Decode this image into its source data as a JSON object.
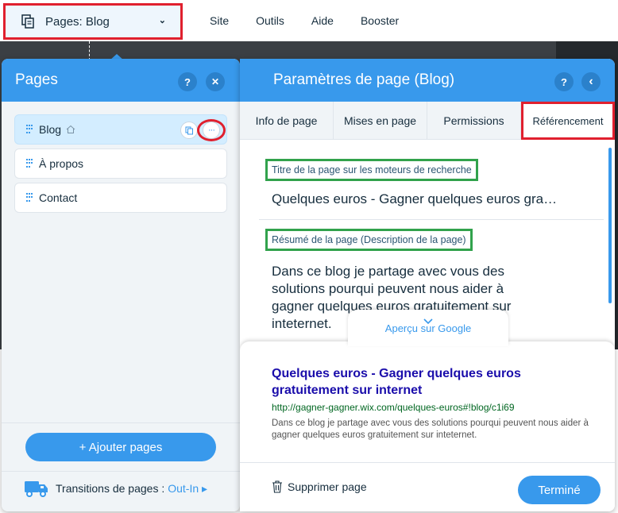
{
  "topbar": {
    "pages_dropdown_label": "Pages: Blog",
    "menu": [
      "Site",
      "Outils",
      "Aide",
      "Booster"
    ]
  },
  "pages_panel": {
    "title": "Pages",
    "help_label": "?",
    "close_label": "✕",
    "items": [
      {
        "label": "Blog"
      },
      {
        "label": "À propos"
      },
      {
        "label": "Contact"
      }
    ],
    "more_label": "···",
    "add_button": "+ Ajouter pages",
    "transitions_label": "Transitions de pages :",
    "transitions_value": "Out-In ▸"
  },
  "settings_panel": {
    "title": "Paramètres de page (Blog)",
    "help_label": "?",
    "back_label": "‹",
    "tabs": [
      "Info de page",
      "Mises en page",
      "Permissions",
      "Référencement"
    ],
    "seo_title_label": "Titre de la page sur les moteurs de recherche",
    "seo_title_value": "Quelques euros - Gagner quelques euros gra…",
    "summary_label": "Résumé de la page (Description de la page)",
    "summary_value": "Dans ce blog je partage avec vous des solutions pourqui peuvent nous aider à gagner quelques euros gratuitement sur inteternet.",
    "google_preview_label": "Aperçu sur Google",
    "google_title": "Quelques euros - Gagner quelques euros gratuitement sur internet",
    "google_url": "http://gagner-gagner.wix.com/quelques-euros#!blog/c1i69",
    "google_desc": "Dans ce blog je partage avec vous des solutions pourqui peuvent nous aider à gagner quelques euros gratuitement sur inteternet.",
    "delete_label": "Supprimer page",
    "done_label": "Terminé"
  },
  "colors": {
    "accent": "#3899ec",
    "highlight_red": "#e0202e",
    "highlight_green": "#31a24c"
  }
}
